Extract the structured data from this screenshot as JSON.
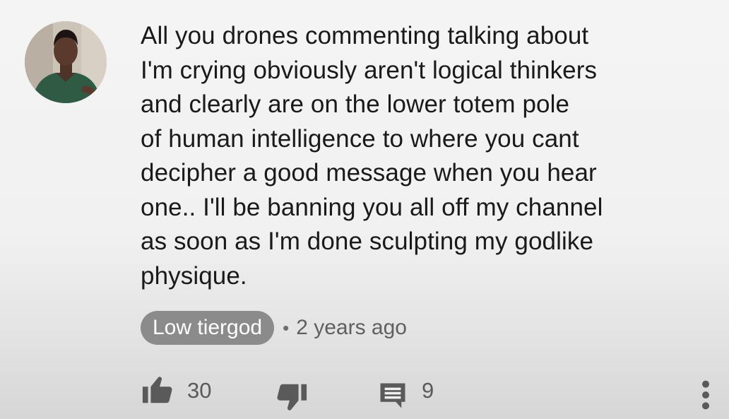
{
  "comment": {
    "text": "All you drones commenting talking about\nI'm crying obviously aren't logical thinkers\nand clearly are on the lower totem pole\nof human intelligence to where you cant\ndecipher a good message when you hear\none.. I'll be banning you all off my channel\nas soon as I'm done sculpting my godlike\nphysique.",
    "author": "Low tiergod",
    "separator": "•",
    "timestamp": "2 years ago",
    "likes": "30",
    "replies": "9"
  },
  "icons": {
    "avatar": "avatar",
    "like": "thumbs-up-icon",
    "dislike": "thumbs-down-icon",
    "reply": "reply-comment-icon",
    "more": "more-vertical-icon"
  },
  "colors": {
    "text": "#1a1a1a",
    "chip": "#8b8b8b",
    "muted": "#5f5f5f",
    "icon": "#5a5a5a"
  }
}
